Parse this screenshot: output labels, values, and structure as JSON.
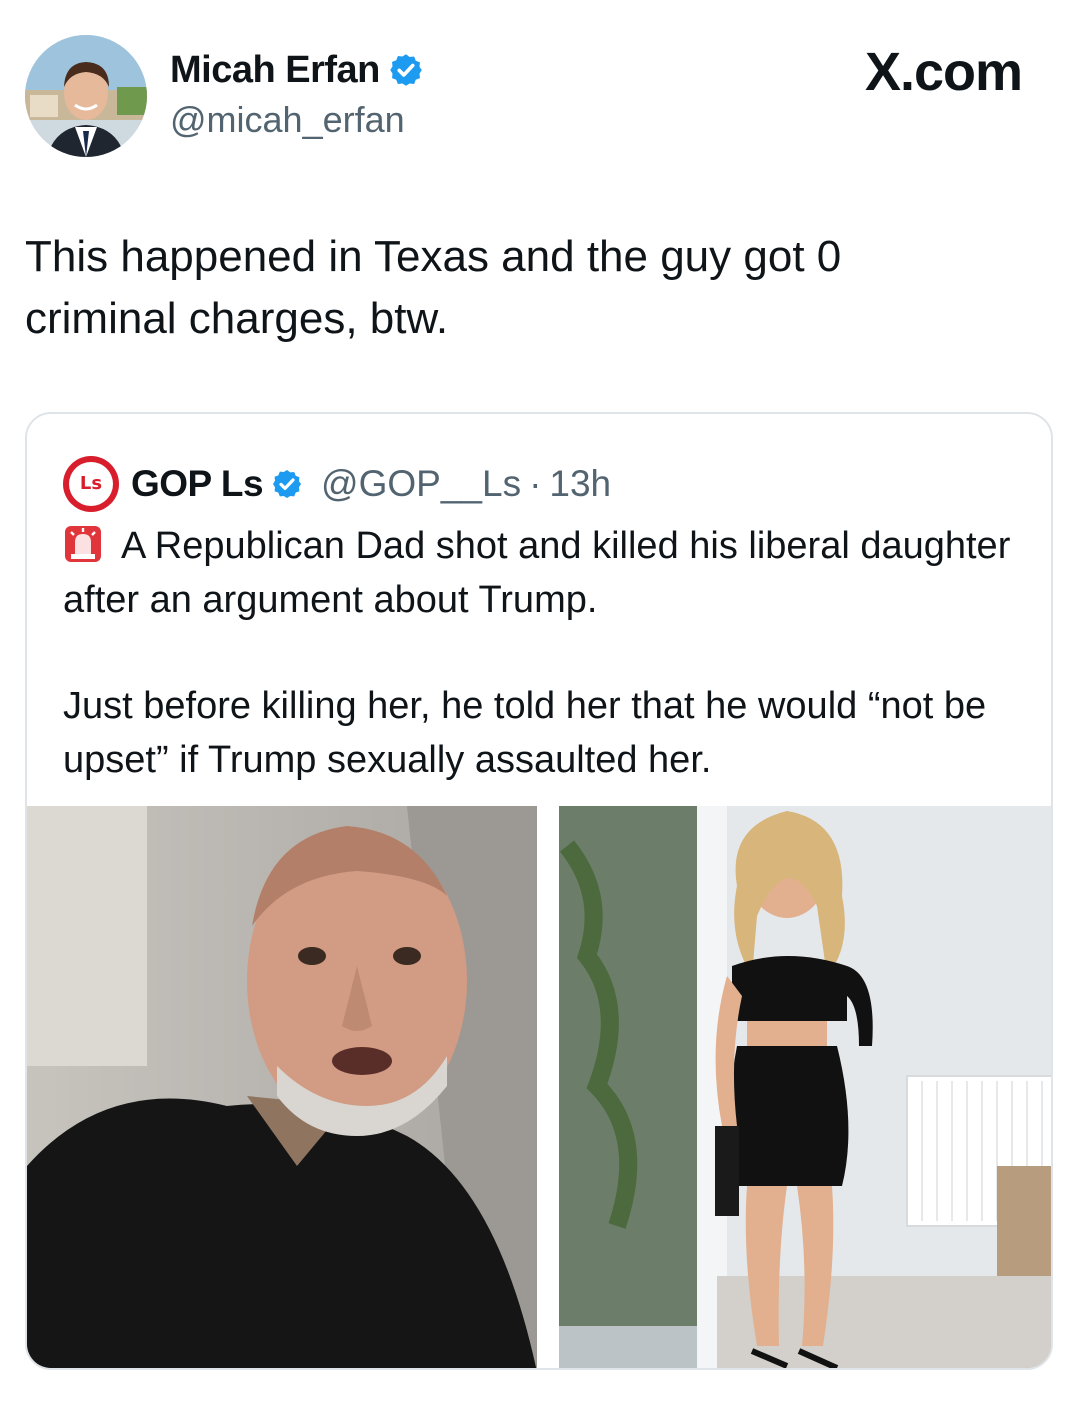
{
  "header": {
    "display_name": "Micah Erfan",
    "handle": "@micah_erfan",
    "brand": "X.com",
    "avatar_icon": "avatar-photo",
    "verified_icon": "verified-badge-icon",
    "verified_color": "#1d9bf0"
  },
  "tweet": {
    "text": "This happened in Texas and the guy got 0\ncriminal charges, btw."
  },
  "quote": {
    "display_name": "GOP Ls",
    "avatar_text": "Ls",
    "avatar_color": "#d81e2c",
    "handle": "@GOP__Ls",
    "separator": "·",
    "time": "13h",
    "siren_icon": "police-light-emoji-icon",
    "paragraph1": "A Republican Dad shot and killed his liberal daughter after an argument about Trump.",
    "paragraph2": "Just before killing her, he told her that he would “not be upset” if Trump sexually assaulted her.",
    "media": [
      {
        "name": "photo-man"
      },
      {
        "name": "photo-woman"
      }
    ]
  }
}
